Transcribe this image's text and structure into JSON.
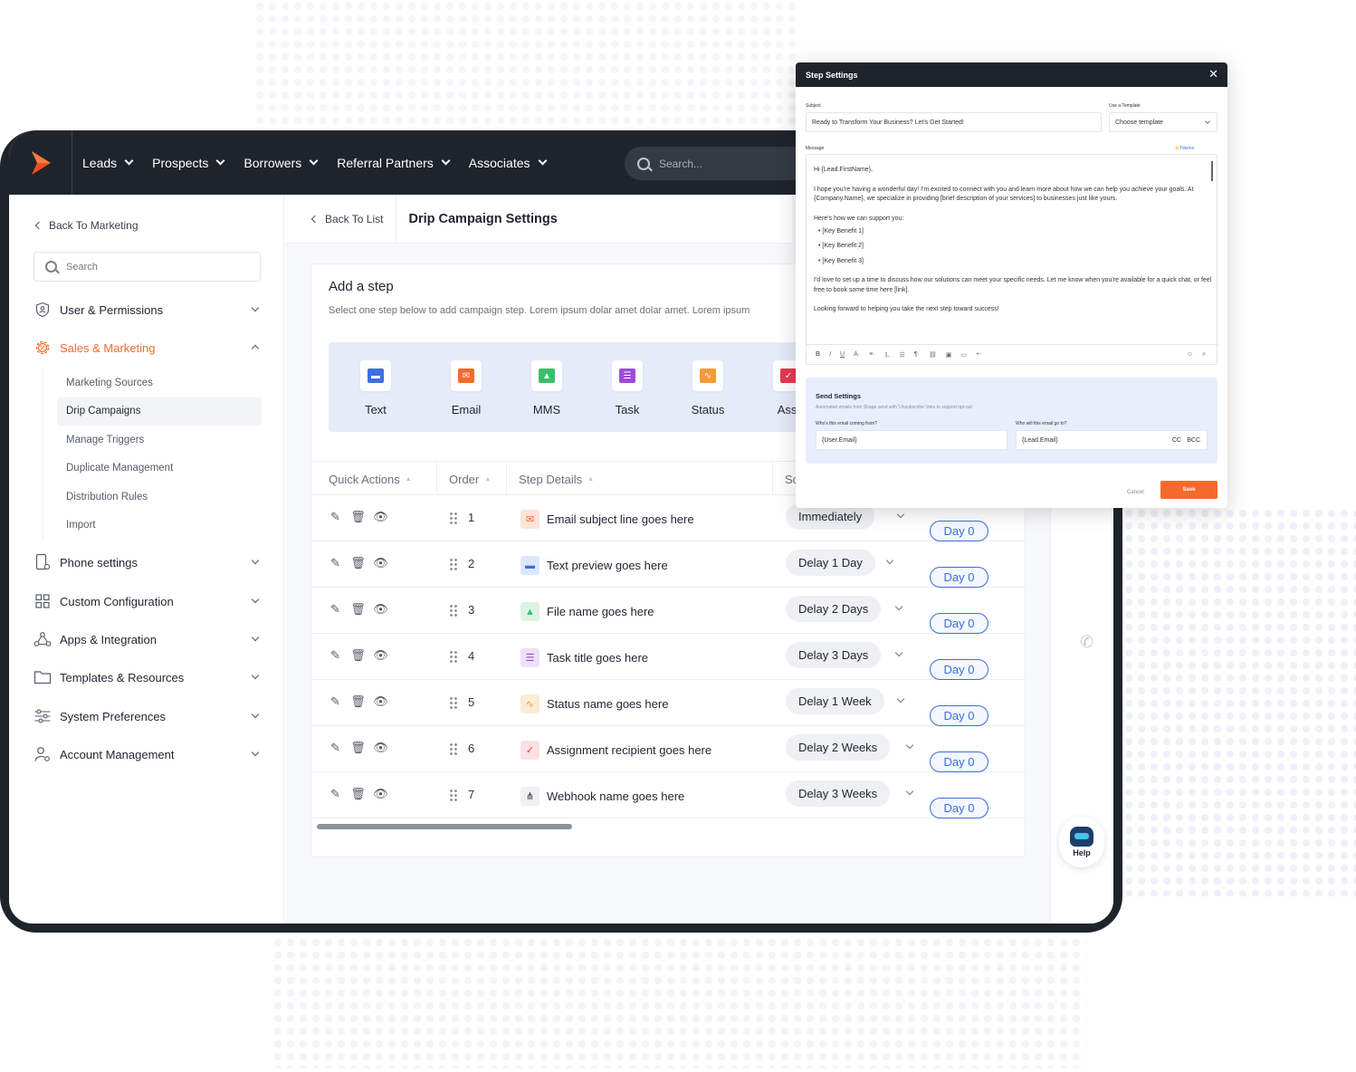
{
  "nav": {
    "items": [
      "Leads",
      "Prospects",
      "Borrowers",
      "Referral Partners",
      "Associates"
    ],
    "search_placeholder": "Search..."
  },
  "sidebar": {
    "back": "Back To Marketing",
    "search_placeholder": "Search",
    "groups": [
      {
        "label": "User & Permissions",
        "icon": "shield-user-icon"
      },
      {
        "label": "Sales & Marketing",
        "icon": "percent-gear-icon",
        "active": true
      },
      {
        "label": "Phone settings",
        "icon": "phone-settings-icon"
      },
      {
        "label": "Custom Configuration",
        "icon": "grid-config-icon"
      },
      {
        "label": "Apps & Integration",
        "icon": "integration-icon"
      },
      {
        "label": "Templates & Resources",
        "icon": "folder-icon"
      },
      {
        "label": "System Preferences",
        "icon": "sliders-icon"
      },
      {
        "label": "Account Management",
        "icon": "account-gear-icon"
      }
    ],
    "sub_items": [
      "Marketing Sources",
      "Drip Campaigns",
      "Manage Triggers",
      "Duplicate Management",
      "Distribution Rules",
      "Import"
    ],
    "selected_sub": "Drip Campaigns"
  },
  "breadcrumb": {
    "back": "Back To List",
    "title": "Drip Campaign Settings"
  },
  "card": {
    "title": "Add a step",
    "subtitle": "Select one step below to add campaign step. Lorem ipsum dolar amet dolar amet. Lorem ipsum",
    "step_types": [
      "Text",
      "Email",
      "MMS",
      "Task",
      "Status",
      "Assi"
    ]
  },
  "table": {
    "headers": [
      "Quick Actions",
      "Order",
      "Step Details",
      "Sc"
    ],
    "rows": [
      {
        "order": "1",
        "detail": "Email subject line goes here",
        "type": "email",
        "schedule": "Immediately",
        "day": "Day 0"
      },
      {
        "order": "2",
        "detail": "Text preview goes here",
        "type": "text",
        "schedule": "Delay 1 Day",
        "day": "Day 0"
      },
      {
        "order": "3",
        "detail": "File name goes here",
        "type": "mms",
        "schedule": "Delay 2 Days",
        "day": "Day 0"
      },
      {
        "order": "4",
        "detail": "Task title goes here",
        "type": "task",
        "schedule": "Delay 3 Days",
        "day": "Day 0"
      },
      {
        "order": "5",
        "detail": "Status name goes here",
        "type": "status",
        "schedule": "Delay 1 Week",
        "day": "Day 0"
      },
      {
        "order": "6",
        "detail": "Assignment recipient goes here",
        "type": "assign",
        "schedule": "Delay 2 Weeks",
        "day": "Day 0"
      },
      {
        "order": "7",
        "detail": "Webhook name goes here",
        "type": "webhook",
        "schedule": "Delay 3 Weeks",
        "day": "Day 0"
      }
    ]
  },
  "help": {
    "label": "Help"
  },
  "modal": {
    "title": "Step Settings",
    "subject_label": "Subject",
    "subject_value": "Ready to Transform Your Business? Let's Get Started!",
    "template_label": "Use a Template",
    "template_value": "Choose template",
    "message_label": "Message",
    "tokens": "Tokens",
    "message": {
      "greeting": "Hi {Lead.FirstName},",
      "p1": "I hope you're having a wonderful day! I'm excited to connect with you and learn more about how we can help you achieve your goals. At {Company.Name}, we specialize in providing [brief description of your services] to businesses just like yours.",
      "p2": "Here's how we can support you:",
      "bullets": [
        "[Key Benefit 1]",
        "[Key Benefit 2]",
        "[Key Benefit 3]"
      ],
      "p3": "I'd love to set up a time to discuss how our solutions can meet your specific needs. Let me know when you're available for a quick chat, or feel free to book some time here [link].",
      "p4": "Looking forward to helping you take the next step toward success!"
    },
    "send": {
      "title": "Send Settings",
      "desc": "Automated emails from Shape send with 'Unsubscribe' links to support opt-out",
      "from_label": "Who's this email coming from?",
      "from_value": "{User.Email}",
      "to_label": "Who will this email go to?",
      "to_value": "{Lead.Email}",
      "cc": "CC",
      "bcc": "BCC"
    },
    "cancel": "Cancel",
    "save": "Save"
  },
  "colors": {
    "accent": "#f36a2b",
    "nav_bg": "#1f242c",
    "link_blue": "#3b6fd6"
  }
}
